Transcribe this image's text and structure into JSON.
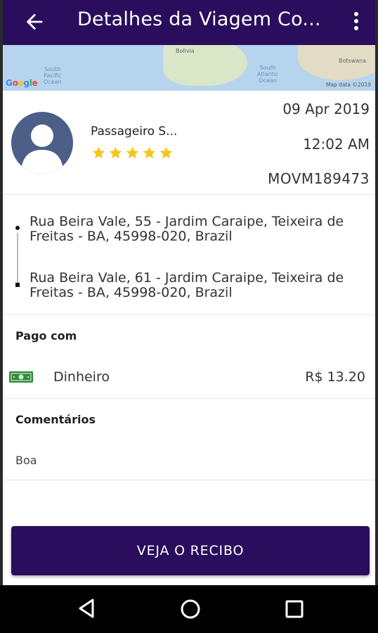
{
  "app_bar": {
    "title": "Detalhes da Viagem Co..."
  },
  "map": {
    "labels": {
      "south_pacific": "South\nPacific\nOcean",
      "south_atlantic": "South\nAtlantic\nOcean",
      "bolivia": "Bolivia",
      "botswana": "Botswana"
    },
    "google_logo": "Google",
    "attribution": "Map data ©2019"
  },
  "passenger": {
    "name": "Passageiro S...",
    "rating": 5,
    "date": "09 Apr 2019",
    "time": "12:02 AM",
    "trip_id": "MOVM189473"
  },
  "route": {
    "pickup": "Rua Beira Vale, 55 - Jardim Caraipe, Teixeira de Freitas - BA, 45998-020, Brazil",
    "dropoff": "Rua Beira Vale, 61 - Jardim Caraipe, Teixeira de Freitas - BA, 45998-020, Brazil"
  },
  "payment": {
    "section_title": "Pago com",
    "method": "Dinheiro",
    "amount": "R$ 13.20"
  },
  "comments": {
    "section_title": "Comentários",
    "text": "Boa"
  },
  "receipt_button": {
    "label": "VEJA O RECIBO"
  },
  "colors": {
    "primary": "#2a0d5c",
    "star": "#f5c518",
    "cash_icon": "#2f8a3a"
  }
}
